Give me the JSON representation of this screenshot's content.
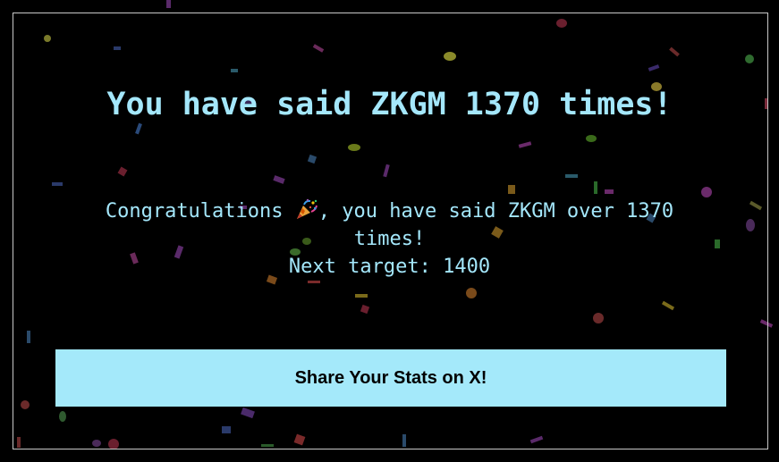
{
  "headline": "You have said ZKGM 1370 times!",
  "message": {
    "prefix": "Congratulations",
    "emoji": "party-popper-icon",
    "suffix": ", you have said ZKGM over 1370 times!",
    "next_target": "Next target: 1400"
  },
  "share_button": {
    "label": "Share Your Stats on X!"
  },
  "colors": {
    "background": "#000000",
    "accent_text": "#a4e7fb",
    "button_bg": "#a4e9fa",
    "button_text": "#000000",
    "frame_border": "#c8c8c8"
  }
}
